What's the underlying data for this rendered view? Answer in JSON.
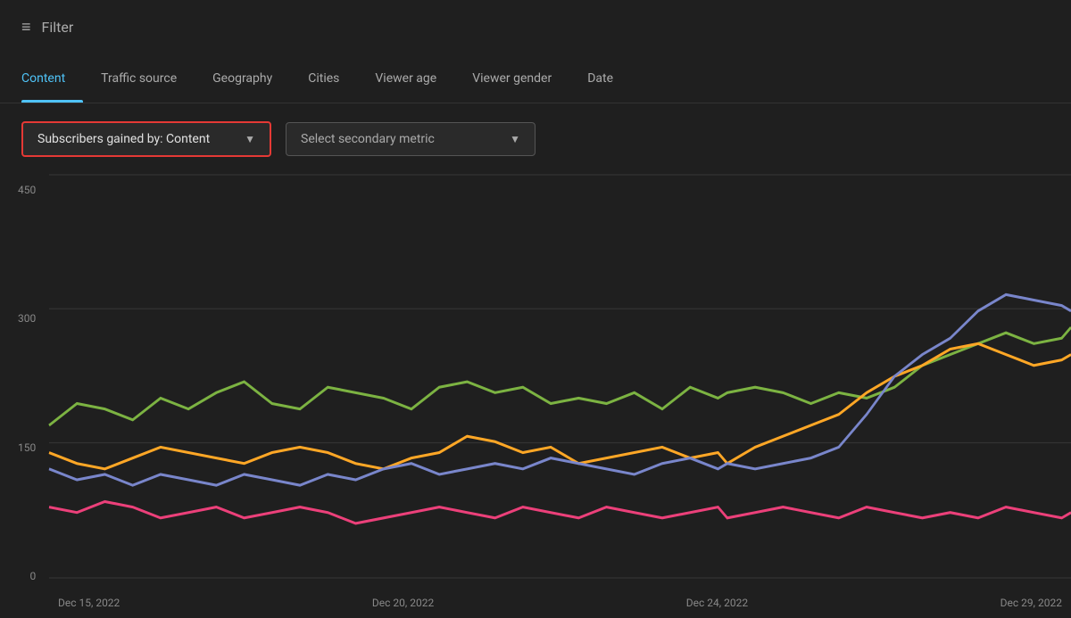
{
  "header": {
    "filter_label": "Filter",
    "filter_icon": "≡"
  },
  "tabs": {
    "items": [
      {
        "id": "content",
        "label": "Content",
        "active": true
      },
      {
        "id": "traffic-source",
        "label": "Traffic source",
        "active": false
      },
      {
        "id": "geography",
        "label": "Geography",
        "active": false
      },
      {
        "id": "cities",
        "label": "Cities",
        "active": false
      },
      {
        "id": "viewer-age",
        "label": "Viewer age",
        "active": false
      },
      {
        "id": "viewer-gender",
        "label": "Viewer gender",
        "active": false
      },
      {
        "id": "date",
        "label": "Date",
        "active": false
      }
    ]
  },
  "controls": {
    "primary_dropdown_label": "Subscribers gained by: Content",
    "secondary_dropdown_label": "Select secondary metric",
    "arrow_symbol": "▼"
  },
  "chart": {
    "y_labels": [
      "450",
      "300",
      "150",
      "0"
    ],
    "x_labels": [
      "Dec 15, 2022",
      "Dec 20, 2022",
      "Dec 24, 2022",
      "Dec 29, 2022"
    ],
    "colors": {
      "green": "#7cb342",
      "orange": "#ffa726",
      "blue": "#7986cb",
      "pink": "#ec407a",
      "teal": "#26c6da"
    }
  }
}
